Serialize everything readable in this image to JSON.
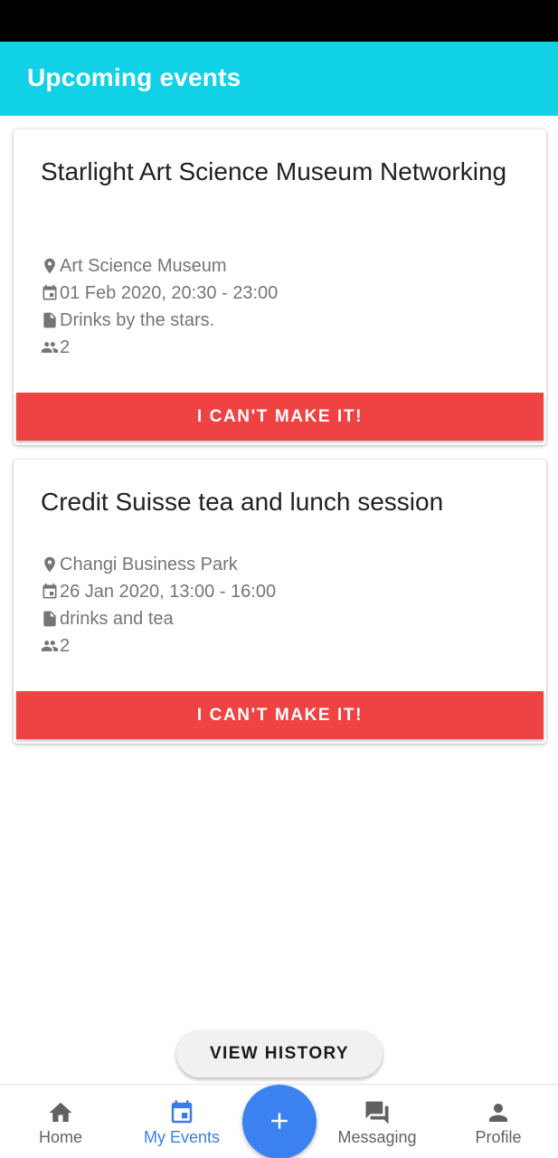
{
  "app_bar": {
    "title": "Upcoming events",
    "color": "#10d1e6"
  },
  "events": [
    {
      "title": "Starlight Art Science Museum Networking",
      "location": "Art Science Museum",
      "datetime": "01 Feb 2020, 20:30 - 23:00",
      "description": "Drinks by the stars.",
      "attendees": "2",
      "button_label": "I CAN'T MAKE IT!"
    },
    {
      "title": "Credit Suisse tea and lunch session",
      "location": "Changi Business Park",
      "datetime": "26 Jan 2020, 13:00 - 16:00",
      "description": "drinks and tea",
      "attendees": "2",
      "button_label": "I CAN'T MAKE IT!"
    }
  ],
  "history_button": {
    "label": "VIEW HISTORY"
  },
  "bottom_nav": {
    "items": [
      {
        "label": "Home",
        "icon": "home-icon",
        "active": false
      },
      {
        "label": "My Events",
        "icon": "calendar-icon",
        "active": true
      },
      {
        "label": "Messaging",
        "icon": "chat-icon",
        "active": false
      },
      {
        "label": "Profile",
        "icon": "person-icon",
        "active": false
      }
    ],
    "fab_icon": "plus-icon"
  },
  "colors": {
    "accent": "#3b82f0",
    "active_nav": "#3b7de8",
    "danger": "#ef4242"
  }
}
